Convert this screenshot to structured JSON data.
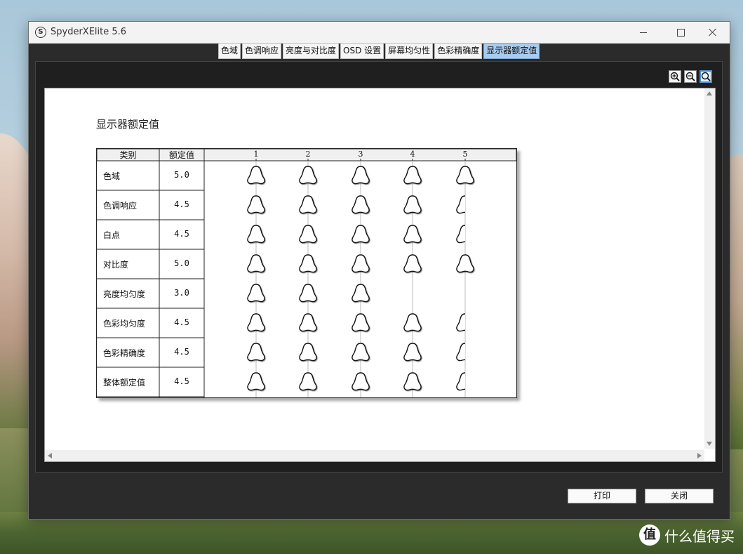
{
  "window": {
    "title": "SpyderXElite 5.6",
    "app_icon_glyph": "S"
  },
  "tabs": [
    {
      "label": "色域",
      "active": false
    },
    {
      "label": "色调响应",
      "active": false
    },
    {
      "label": "亮度与对比度",
      "active": false
    },
    {
      "label": "OSD 设置",
      "active": false
    },
    {
      "label": "屏幕均匀性",
      "active": false
    },
    {
      "label": "色彩精确度",
      "active": false
    },
    {
      "label": "显示器额定值",
      "active": true
    }
  ],
  "zoom_tools": [
    "zoom-in-icon",
    "zoom-out-icon",
    "zoom-fit-icon"
  ],
  "report": {
    "title": "显示器额定值",
    "headers": {
      "category": "类别",
      "rating": "额定值"
    },
    "columns": [
      "1",
      "2",
      "3",
      "4",
      "5"
    ],
    "rows": [
      {
        "category": "色域",
        "rating": "5.0",
        "score": 5.0
      },
      {
        "category": "色调响应",
        "rating": "4.5",
        "score": 4.5
      },
      {
        "category": "白点",
        "rating": "4.5",
        "score": 4.5
      },
      {
        "category": "对比度",
        "rating": "5.0",
        "score": 5.0
      },
      {
        "category": "亮度均匀度",
        "rating": "3.0",
        "score": 3.0
      },
      {
        "category": "色彩均匀度",
        "rating": "4.5",
        "score": 4.5
      },
      {
        "category": "色彩精确度",
        "rating": "4.5",
        "score": 4.5
      },
      {
        "category": "整体额定值",
        "rating": "4.5",
        "score": 4.5
      }
    ]
  },
  "buttons": {
    "print": "打印",
    "close": "关闭"
  },
  "watermark": {
    "logo": "值",
    "text": "什么值得买"
  }
}
